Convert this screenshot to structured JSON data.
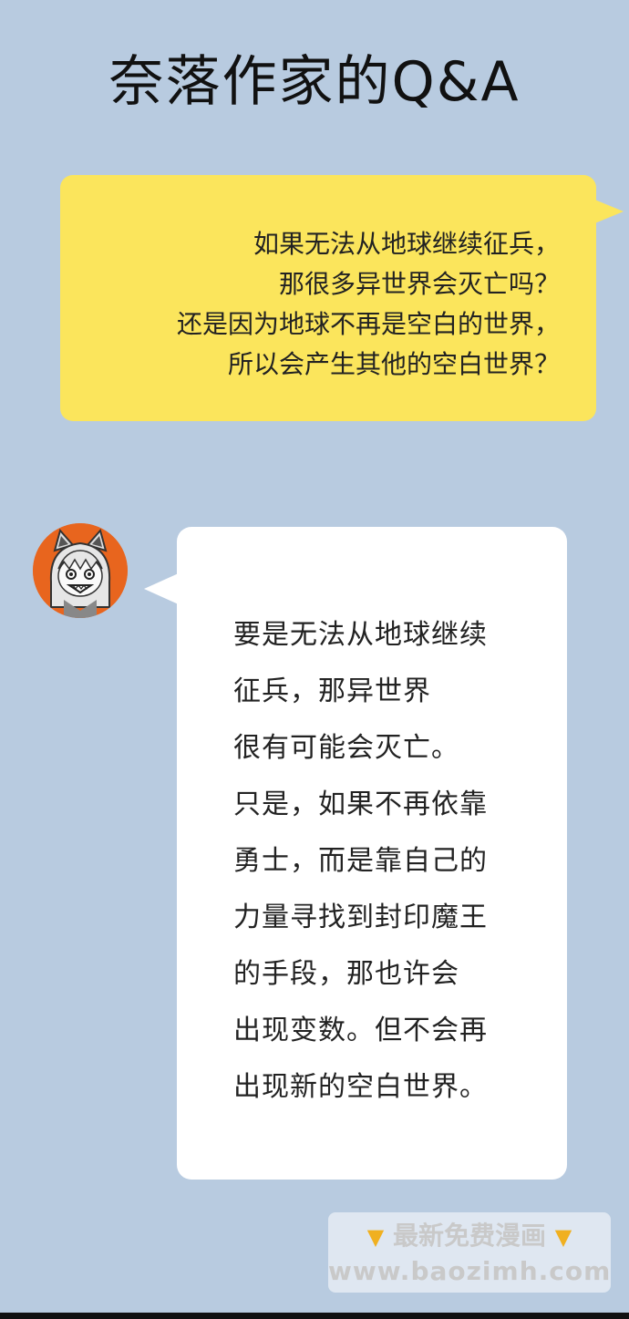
{
  "title": "奈落作家的Q&A",
  "question": {
    "lines": [
      "如果无法从地球继续征兵，",
      "那很多异世界会灭亡吗？",
      "还是因为地球不再是空白的世界，",
      "所以会产生其他的空白世界？"
    ],
    "bubble_color": "#fbe55c"
  },
  "answer": {
    "lines": [
      "要是无法从地球继续",
      "征兵，那异世界",
      "很有可能会灭亡。",
      "只是，如果不再依靠",
      "勇士，而是靠自己的",
      "力量寻找到封印魔王",
      "的手段，那也许会",
      "出现变数。但不会再",
      "出现新的空白世界。"
    ],
    "avatar_icon": "author-avatar-icon",
    "bubble_color": "#ffffff"
  },
  "watermark": {
    "line1": "最新免费漫画",
    "line2": "www.baozimh.com",
    "icon": "pointing-down-hand-icon"
  },
  "colors": {
    "background": "#b8cbe0",
    "avatar_bg": "#e8651e"
  }
}
